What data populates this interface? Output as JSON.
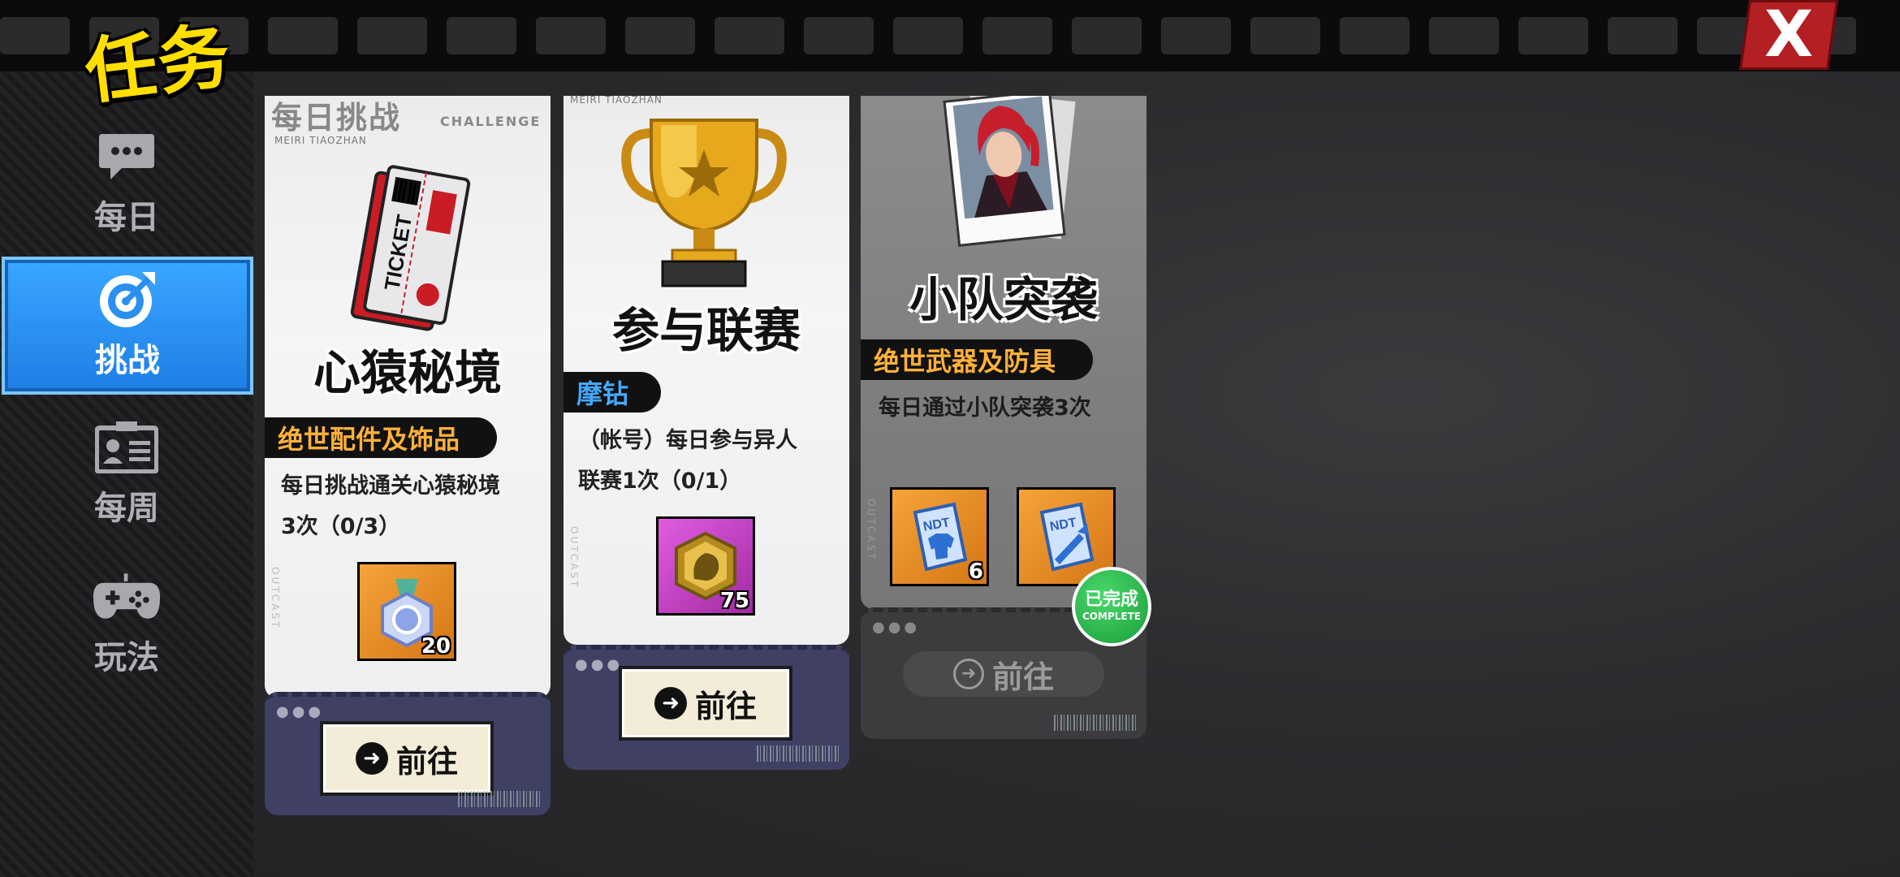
{
  "header": {
    "title": "任务",
    "close_label": "X"
  },
  "sidebar": {
    "items": [
      {
        "label": "每日",
        "icon": "chat-bubble-icon",
        "active": false
      },
      {
        "label": "挑战",
        "icon": "target-icon",
        "active": true
      },
      {
        "label": "每周",
        "icon": "id-card-icon",
        "active": false
      },
      {
        "label": "玩法",
        "icon": "gamepad-icon",
        "active": false
      }
    ]
  },
  "cards": [
    {
      "header": "每日挑战",
      "header_sub": "CHALLENGE",
      "header_pinyin": "MEIRI TIAOZHAN",
      "vertical": "OUTCAST",
      "art": "ticket-icon",
      "art_text": "TICKET",
      "name": "心猿秘境",
      "reward_tag": "绝世配件及饰品",
      "desc_line1": "每日挑战通关心猿秘境",
      "desc_line2": "3次（0/3）",
      "items": [
        {
          "icon": "medal-icon",
          "count": "20",
          "rarity": "orange"
        }
      ],
      "button": "前往",
      "completed": false
    },
    {
      "header_pinyin": "MEIRI TIAOZHAN",
      "vertical": "OUTCAST",
      "art": "trophy-icon",
      "name": "参与联赛",
      "reward_tag": "摩钻",
      "desc_line1": "（帐号）每日参与异人",
      "desc_line2": "联赛1次（0/1）",
      "items": [
        {
          "icon": "lion-coin-icon",
          "count": "75",
          "rarity": "purple"
        }
      ],
      "button": "前往",
      "completed": false
    },
    {
      "vertical": "OUTCAST",
      "art": "character-photo-icon",
      "name": "小队突袭",
      "reward_tag": "绝世武器及防具",
      "desc_line1": "每日通过小队突袭3次",
      "items": [
        {
          "icon": "armor-blueprint-icon",
          "count": "6",
          "rarity": "orange",
          "label": "NDT"
        },
        {
          "icon": "weapon-blueprint-icon",
          "count": "",
          "rarity": "orange",
          "label": "NDT"
        }
      ],
      "badge_cn": "已完成",
      "badge_en": "COMPLETE",
      "button": "前往",
      "completed": true
    }
  ],
  "colors": {
    "accent_blue": "#2a8ff0",
    "title_yellow": "#ffde00",
    "reward_orange": "#ffb13a",
    "close_red": "#b41f24",
    "complete_green": "#1fae44"
  }
}
